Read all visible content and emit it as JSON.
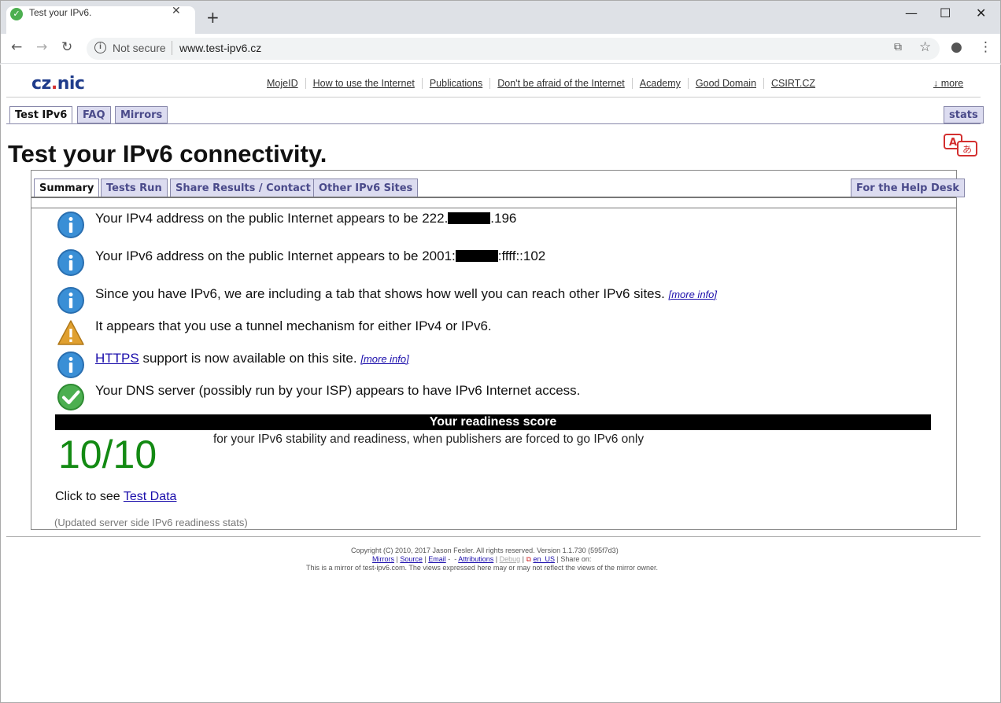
{
  "browser": {
    "tab_title": "Test your IPv6.",
    "security_label": "Not secure",
    "url": "www.test-ipv6.cz"
  },
  "site_header": {
    "logo_text": "cz.nic",
    "nav": [
      "MojeID",
      "How to use the Internet",
      "Publications",
      "Don't be afraid of the Internet",
      "Academy",
      "Good Domain",
      "CSIRT.CZ"
    ],
    "more_label": "↓ more"
  },
  "outer_tabs": {
    "test_ipv6": "Test IPv6",
    "faq": "FAQ",
    "mirrors": "Mirrors",
    "stats": "stats"
  },
  "page_title": "Test your IPv6 connectivity.",
  "inner_tabs": {
    "summary": "Summary",
    "tests_run": "Tests Run",
    "share": "Share Results / Contact",
    "other_sites": "Other IPv6 Sites",
    "help_desk": "For the Help Desk"
  },
  "messages": {
    "ipv4_prefix": "Your IPv4 address on the public Internet appears to be 222.",
    "ipv4_suffix": ".196",
    "ipv6_prefix": "Your IPv6 address on the public Internet appears to be 2001:",
    "ipv6_suffix": ":ffff::102",
    "have_ipv6": "Since you have IPv6, we are including a tab that shows how well you can reach other IPv6 sites.",
    "more_info": "[more info]",
    "tunnel": "It appears that you use a tunnel mechanism for either IPv4 or IPv6.",
    "https_link": "HTTPS",
    "https_rest": " support is now available on this site.",
    "dns": "Your DNS server (possibly run by your ISP) appears to have IPv6 Internet access."
  },
  "score": {
    "heading": "Your readiness score",
    "value": "10/10",
    "description": "for your IPv6 stability and readiness, when publishers are forced to go IPv6 only"
  },
  "click_to_see": "Click to see ",
  "test_data_link": "Test Data",
  "updated_stats": "(Updated server side IPv6 readiness stats)",
  "footer": {
    "copyright": "Copyright (C) 2010, 2017 Jason Fesler. All rights reserved. Version 1.1.730 (595f7d3)",
    "mirrors": "Mirrors",
    "source": "Source",
    "email": "Email",
    "attributions": "Attributions",
    "debug": "Debug",
    "locale": "en_US",
    "share_on": "Share on:",
    "mirror_note": "This is a mirror of test-ipv6.com. The views expressed here may or may not reflect the views of the mirror owner."
  },
  "colors": {
    "info_blue": "#3a8fd6",
    "warning_orange": "#e0a030",
    "check_green": "#4caf50",
    "score_green": "#138a13",
    "tab_purple": "#4a4a8a"
  }
}
